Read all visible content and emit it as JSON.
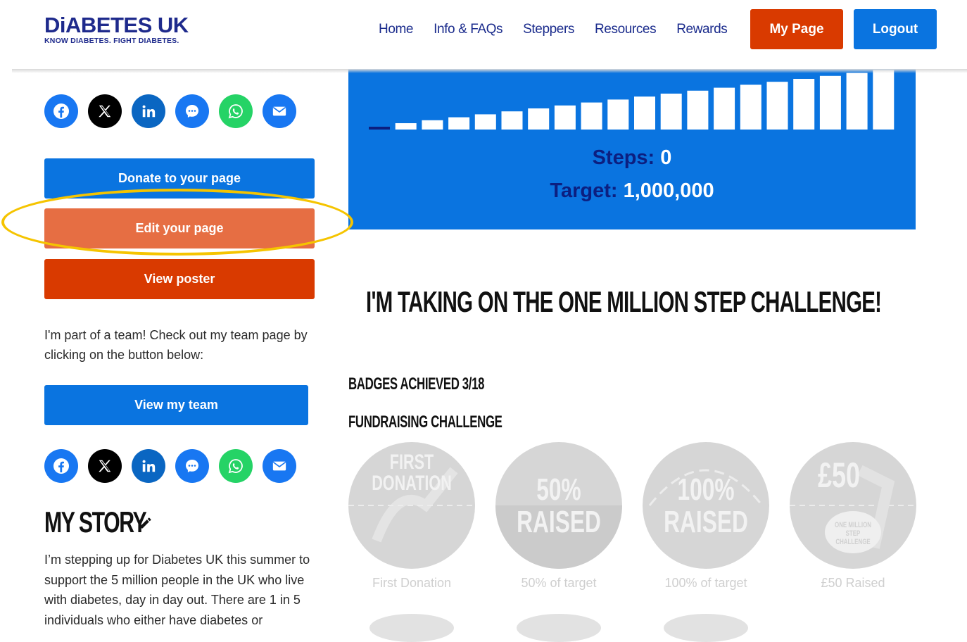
{
  "header": {
    "logo_main": "DiABETES UK",
    "logo_tag": "KNOW DIABETES. FIGHT DIABETES.",
    "nav": [
      "Home",
      "Info & FAQs",
      "Steppers",
      "Resources",
      "Rewards"
    ],
    "my_page_label": "My Page",
    "logout_label": "Logout"
  },
  "colors": {
    "brand_blue": "#0a74e0",
    "brand_navy": "#1e2a8c",
    "orange_red": "#d93a00",
    "edit_orange": "#e66e43",
    "highlight_yellow": "#f5c400"
  },
  "share_icons": [
    "facebook-icon",
    "x-icon",
    "linkedin-icon",
    "messenger-icon",
    "whatsapp-icon",
    "email-icon"
  ],
  "sidebar": {
    "donate_label": "Donate to your page",
    "edit_label": "Edit your page",
    "poster_label": "View poster",
    "team_text": "I'm part of a team! Check out my team page by clicking on the button below:",
    "team_button_label": "View my team",
    "story_title": "MY STORY",
    "story_text": "I’m stepping up for Diabetes UK this summer to support the 5 million people in the UK who live with diabetes, day in day out. There are 1 in 5 individuals who either have diabetes or"
  },
  "progress": {
    "steps_label": "Steps:",
    "steps_value": "0",
    "target_label": "Target:",
    "target_value": "1,000,000",
    "step_bars": 20,
    "achieved_bars": 0
  },
  "main": {
    "challenge_title": "I'M TAKING ON THE ONE MILLION STEP CHALLENGE!",
    "badges_title": "BADGES ACHIEVED 3/18",
    "fundraising_title": "FUNDRAISING CHALLENGE",
    "badges": [
      {
        "line1": "FIRST",
        "line2": "DONATION",
        "caption": "First Donation"
      },
      {
        "line1": "50%",
        "line2": "RAISED",
        "caption": "50% of target"
      },
      {
        "line1": "100%",
        "line2": "RAISED",
        "caption": "100% of target"
      },
      {
        "line1": "£50",
        "line2": "ONE MILLION STEP CHALLENGE",
        "caption": "£50 Raised"
      }
    ]
  }
}
